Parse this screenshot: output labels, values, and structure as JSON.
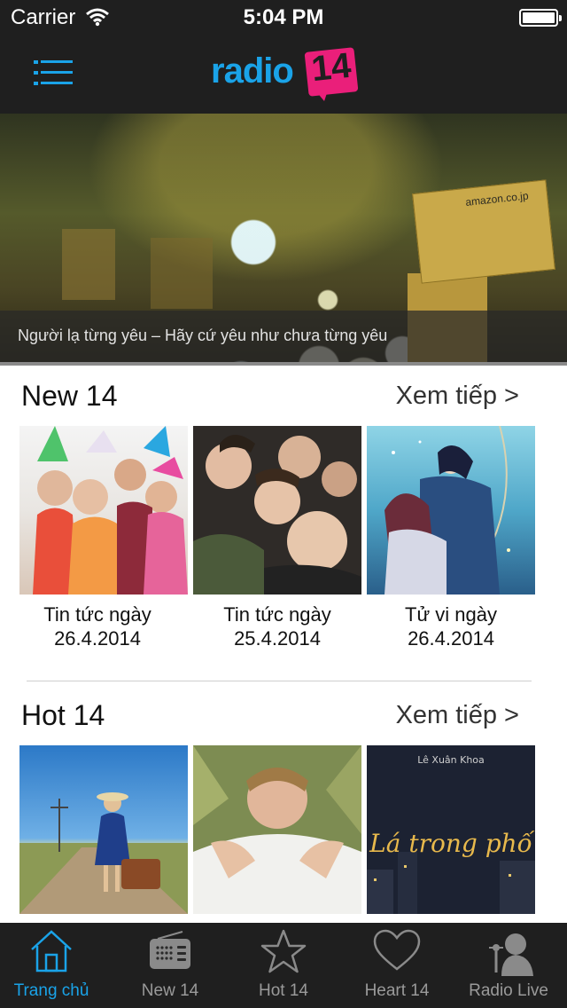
{
  "status_bar": {
    "carrier": "Carrier",
    "time": "5:04 PM"
  },
  "nav": {
    "logo_text": "radio",
    "logo_badge": "14"
  },
  "hero": {
    "caption": "Người lạ từng yêu – Hãy cứ yêu như chưa từng yêu",
    "box_label": "amazon.co.jp",
    "page_count": 3,
    "active_page": 1
  },
  "sections": [
    {
      "title": "New 14",
      "more": "Xem tiếp >",
      "items": [
        {
          "line1": "Tin tức ngày",
          "line2": "26.4.2014"
        },
        {
          "line1": "Tin tức ngày",
          "line2": "25.4.2014"
        },
        {
          "line1": "Tử vi ngày",
          "line2": "26.4.2014"
        }
      ]
    },
    {
      "title": "Hot 14",
      "more": "Xem tiếp >",
      "items": [
        {
          "line1": "",
          "line2": ""
        },
        {
          "line1": "",
          "line2": ""
        },
        {
          "line1": "Lê Xuân Khoa",
          "line2": "Lá trong phố"
        }
      ]
    }
  ],
  "tabbar": {
    "active": 0,
    "tabs": [
      {
        "label": "Trang chủ",
        "icon": "home-icon"
      },
      {
        "label": "New 14",
        "icon": "radio-icon"
      },
      {
        "label": "Hot 14",
        "icon": "star-icon"
      },
      {
        "label": "Heart 14",
        "icon": "heart-icon"
      },
      {
        "label": "Radio Live",
        "icon": "singer-icon"
      }
    ]
  },
  "colors": {
    "accent": "#1aa3e8",
    "brand_pink": "#ea1f7a",
    "bar_bg": "#1f1f1f"
  }
}
